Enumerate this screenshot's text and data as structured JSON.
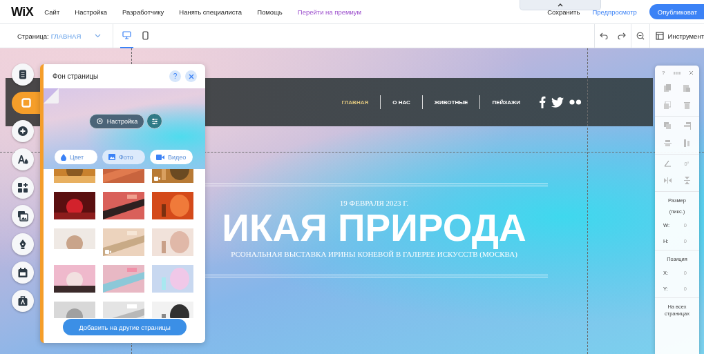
{
  "topbar": {
    "logo": "WiX",
    "menu": [
      {
        "label": "Сайт",
        "kind": "plain"
      },
      {
        "label": "Настройка",
        "kind": "plain"
      },
      {
        "label": "Разработчику",
        "kind": "plain"
      },
      {
        "label": "Нанять специалиста",
        "kind": "plain"
      },
      {
        "label": "Помощь",
        "kind": "plain"
      },
      {
        "label": "Перейти на премиум",
        "kind": "premium"
      }
    ],
    "save": "Сохранить",
    "preview": "Предпросмотр",
    "publish": "Опубликоват"
  },
  "toolbar": {
    "page_label": "Страница:",
    "page_value": "ГЛАВНАЯ",
    "devices": [
      {
        "kind": "desktop",
        "selected": true
      },
      {
        "kind": "mobile",
        "selected": false
      }
    ],
    "tools_label": "Инструмент"
  },
  "left_rail": [
    {
      "kind": "pages",
      "selected": false
    },
    {
      "kind": "background",
      "selected": true
    },
    {
      "kind": "add",
      "selected": false
    },
    {
      "kind": "design",
      "selected": false
    },
    {
      "kind": "apps",
      "selected": false
    },
    {
      "kind": "media",
      "selected": false
    },
    {
      "kind": "pen",
      "selected": false
    },
    {
      "kind": "calendar",
      "selected": false
    },
    {
      "kind": "portfolio",
      "selected": false
    }
  ],
  "background_panel": {
    "title": "Фон страницы",
    "help": "?",
    "customize": "Настройка",
    "tabs": [
      {
        "label": "Цвет",
        "kind": "color",
        "selected": false
      },
      {
        "label": "Фото",
        "selected": true
      },
      {
        "label": "Видео",
        "kind": "video",
        "selected": false
      }
    ],
    "photos": [
      {
        "kind": "picture",
        "video": false
      },
      {
        "kind": "picture",
        "video": false
      },
      {
        "kind": "picture",
        "video": true
      },
      {
        "kind": "picture",
        "video": false
      },
      {
        "kind": "picture",
        "video": false
      },
      {
        "kind": "picture",
        "video": false
      },
      {
        "kind": "picture",
        "video": false
      },
      {
        "kind": "picture",
        "video": true
      },
      {
        "kind": "picture",
        "video": false
      },
      {
        "kind": "picture",
        "video": false
      },
      {
        "kind": "picture",
        "video": false
      },
      {
        "kind": "picture",
        "video": false
      },
      {
        "kind": "picture",
        "video": false
      },
      {
        "kind": "picture",
        "video": false
      },
      {
        "kind": "picture",
        "video": false
      }
    ],
    "add_button": "Добавить на другие страницы"
  },
  "site": {
    "nav": [
      {
        "label": "ГЛАВНАЯ",
        "selected": true
      },
      {
        "label": "О НАС",
        "selected": false
      },
      {
        "label": "ЖИВОТНЫЕ",
        "selected": false
      },
      {
        "label": "ПЕЙЗАЖИ",
        "selected": false
      }
    ],
    "date": "19 ФЕВРАЛЯ 2023 Г.",
    "title": "ИКАЯ ПРИРОДА",
    "subtitle": "РСОНАЛЬНАЯ ВЫСТАВКА ИРИНЫ КОНЕВОЙ В ГАЛЕРЕЕ ИСКУССТВ (МОСКВА)"
  },
  "inspector": {
    "help": "?",
    "angle": "0°",
    "size_title": "Размер",
    "size_unit": "(пикс.)",
    "size_fields": [
      {
        "label": "W:",
        "value": "0"
      },
      {
        "label": "H:",
        "value": "0"
      }
    ],
    "position_title": "Позиция",
    "position_fields": [
      {
        "label": "X:",
        "value": "0"
      },
      {
        "label": "Y:",
        "value": "0"
      }
    ],
    "all_pages": "На всех страницах"
  }
}
